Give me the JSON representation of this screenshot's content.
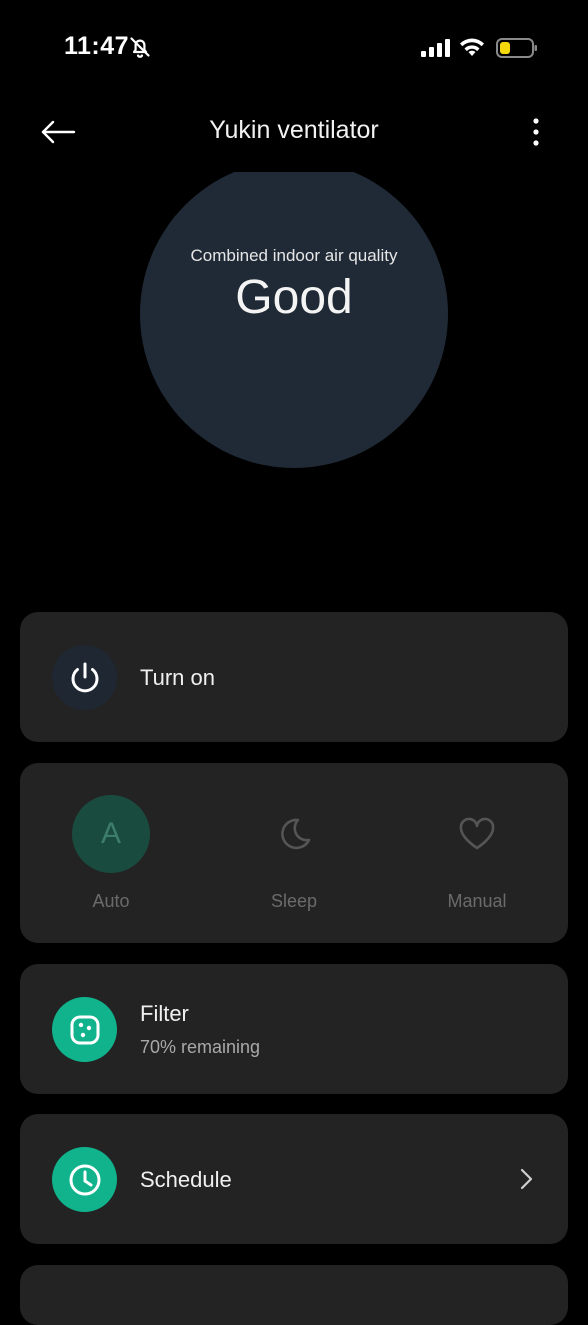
{
  "status_bar": {
    "time": "11:47",
    "icons": [
      "bell-off-icon",
      "signal-icon",
      "wifi-icon",
      "battery-icon"
    ],
    "battery_color": "#f5d90a"
  },
  "header": {
    "title": "Yukin ventilator",
    "back_icon": "arrow-left-icon",
    "more_icon": "more-vertical-icon"
  },
  "air_quality": {
    "label": "Combined indoor air quality",
    "value": "Good",
    "circle_color": "#202a36"
  },
  "power": {
    "label": "Turn on",
    "icon": "power-icon"
  },
  "modes": {
    "items": [
      {
        "letter": "A",
        "label": "Auto",
        "icon": "auto-icon",
        "active": true
      },
      {
        "label": "Sleep",
        "icon": "moon-icon",
        "active": false
      },
      {
        "label": "Manual",
        "icon": "heart-icon",
        "active": false
      }
    ]
  },
  "filter": {
    "title": "Filter",
    "status": "70% remaining",
    "icon": "filter-icon"
  },
  "schedule": {
    "title": "Schedule",
    "icon": "clock-icon",
    "chevron_icon": "chevron-right-icon"
  },
  "colors": {
    "accent": "#10b38b",
    "card_bg": "#232323",
    "background": "#000000"
  }
}
